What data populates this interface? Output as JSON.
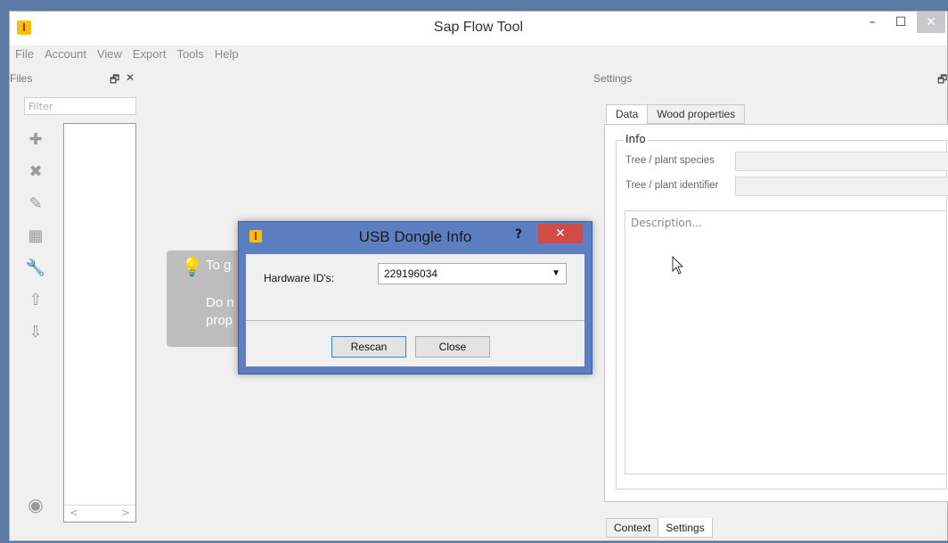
{
  "window": {
    "title": "Sap Flow Tool",
    "controls": {
      "minimize": "–",
      "maximize": "☐",
      "close": "✕"
    }
  },
  "menu": [
    "File",
    "Account",
    "View",
    "Export",
    "Tools",
    "Help"
  ],
  "files_panel": {
    "title": "Files",
    "float_icon": "🗗",
    "close_icon": "✕",
    "filter_placeholder": "Filter",
    "tools": [
      {
        "icon": "add-icon",
        "glyph": "✚"
      },
      {
        "icon": "remove-icon",
        "glyph": "✖"
      },
      {
        "icon": "pencil-icon",
        "glyph": "✎"
      },
      {
        "icon": "keypad-icon",
        "glyph": "▦"
      },
      {
        "icon": "wrench-icon",
        "glyph": "🔧"
      },
      {
        "icon": "arrow-up-icon",
        "glyph": "⇧"
      },
      {
        "icon": "arrow-down-icon",
        "glyph": "⇩"
      }
    ],
    "eye_icon": "◉",
    "scroll_left": "<",
    "scroll_right": ">"
  },
  "hint": {
    "line1": "To g",
    "line2": "Do n",
    "line3": "prop"
  },
  "settings_panel": {
    "title": "Settings",
    "float_icon": "🗗",
    "tabs": [
      "Data",
      "Wood properties"
    ],
    "group_title": "Info",
    "fields": [
      {
        "label": "Tree / plant species",
        "value": ""
      },
      {
        "label": "Tree / plant identifier",
        "value": ""
      }
    ],
    "description_placeholder": "Description...",
    "bottom_tabs": [
      "Context",
      "Settings"
    ]
  },
  "dialog": {
    "title": "USB Dongle Info",
    "help": "?",
    "close": "✕",
    "hardware_label": "Hardware ID's:",
    "hardware_value": "229196034",
    "buttons": {
      "rescan": "Rescan",
      "close": "Close"
    }
  }
}
